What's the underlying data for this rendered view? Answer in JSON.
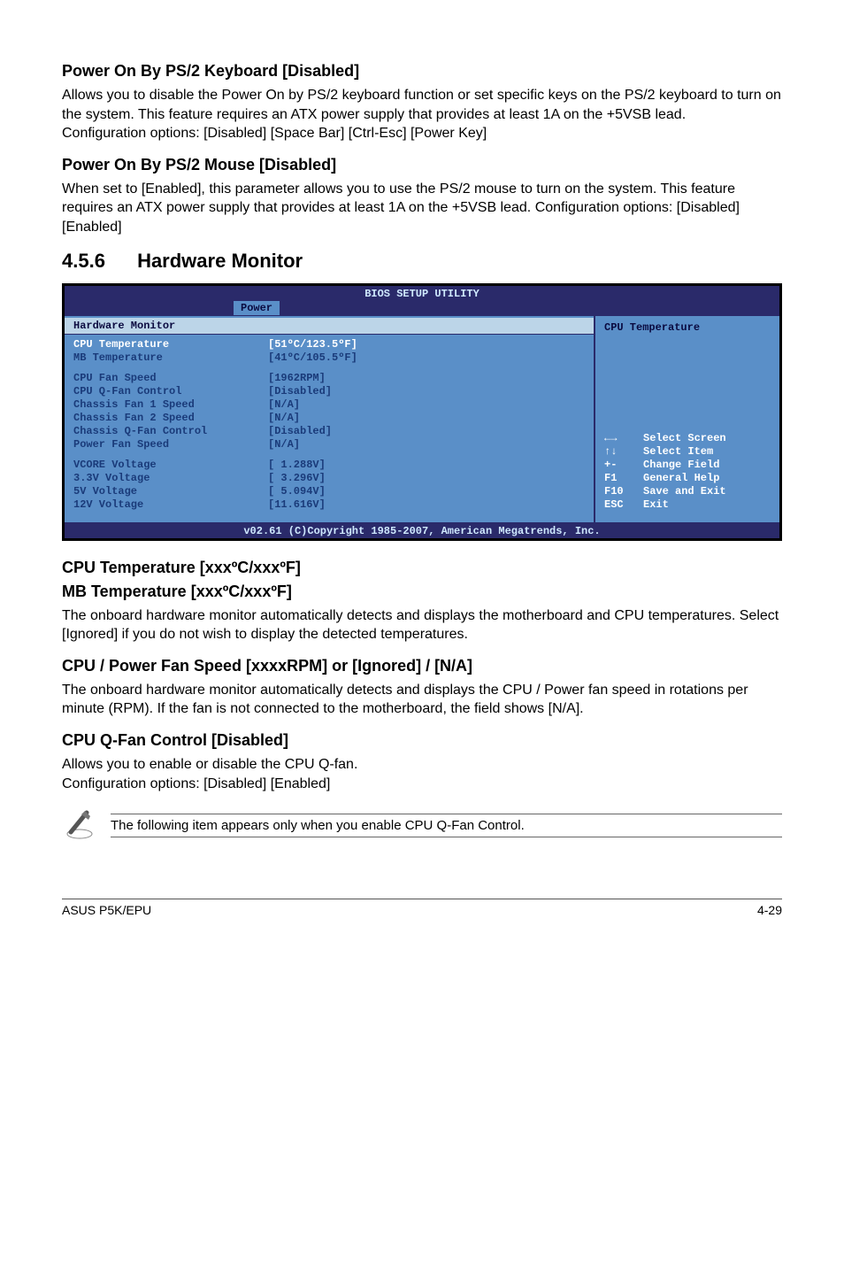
{
  "sections": {
    "ps2kb": {
      "title": "Power On By PS/2 Keyboard [Disabled]",
      "body": "Allows you to disable the Power On by PS/2 keyboard function or set specific keys on the PS/2 keyboard to turn on the system. This feature requires an ATX power supply that provides at least 1A on the +5VSB lead.",
      "opts": "Configuration options: [Disabled] [Space Bar] [Ctrl-Esc] [Power Key]"
    },
    "ps2mouse": {
      "title": "Power On By PS/2 Mouse [Disabled]",
      "body": "When set to [Enabled], this parameter allows you to use the PS/2 mouse to turn on the system. This feature requires an ATX power supply that provides at least 1A on the +5VSB lead. Configuration options: [Disabled] [Enabled]"
    },
    "hwmon": {
      "num": "4.5.6",
      "title": "Hardware Monitor"
    },
    "cputemp": {
      "title1": "CPU Temperature [xxxºC/xxxºF]",
      "title2": "MB Temperature [xxxºC/xxxºF]",
      "body": "The onboard hardware monitor automatically detects and displays the motherboard and CPU temperatures. Select [Ignored] if you do not wish to display the detected temperatures."
    },
    "fanspeed": {
      "title": "CPU / Power Fan Speed [xxxxRPM] or [Ignored] / [N/A]",
      "body": "The onboard hardware monitor automatically detects and displays the CPU / Power fan speed in rotations per minute (RPM). If the fan is not connected to the motherboard, the field shows [N/A]."
    },
    "qfan": {
      "title": "CPU Q-Fan Control [Disabled]",
      "body": "Allows you to enable or disable the CPU Q-fan.",
      "opts": "Configuration options: [Disabled] [Enabled]"
    },
    "note": "The following item appears only when you enable CPU Q-Fan Control."
  },
  "bios": {
    "title": "BIOS SETUP UTILITY",
    "tab": "Power",
    "group": "Hardware Monitor",
    "help": "CPU Temperature",
    "rows1": [
      {
        "label": "CPU Temperature",
        "val": "[51ºC/123.5ºF]",
        "sel": true
      },
      {
        "label": "MB Temperature",
        "val": "[41ºC/105.5ºF]"
      }
    ],
    "rows2": [
      {
        "label": "CPU Fan Speed",
        "val": "[1962RPM]"
      },
      {
        "label": "CPU Q-Fan Control",
        "val": "[Disabled]"
      },
      {
        "label": "Chassis Fan 1 Speed",
        "val": "[N/A]"
      },
      {
        "label": "Chassis Fan 2 Speed",
        "val": "[N/A]"
      },
      {
        "label": "Chassis Q-Fan Control",
        "val": "[Disabled]"
      },
      {
        "label": "Power Fan Speed",
        "val": "[N/A]"
      }
    ],
    "rows3": [
      {
        "label": "VCORE Voltage",
        "val": "[ 1.288V]"
      },
      {
        "label": "3.3V  Voltage",
        "val": "[ 3.296V]"
      },
      {
        "label": "5V    Voltage",
        "val": "[ 5.094V]"
      },
      {
        "label": "12V   Voltage",
        "val": "[11.616V]"
      }
    ],
    "nav": [
      {
        "key": "←→",
        "txt": "Select Screen"
      },
      {
        "key": "↑↓",
        "txt": "Select Item"
      },
      {
        "key": "+-",
        "txt": " Change Field"
      },
      {
        "key": "F1",
        "txt": "General Help"
      },
      {
        "key": "F10",
        "txt": "Save and Exit"
      },
      {
        "key": "ESC",
        "txt": "Exit"
      }
    ],
    "footer": "v02.61 (C)Copyright 1985-2007, American Megatrends, Inc."
  },
  "pagefooter": {
    "left": "ASUS P5K/EPU",
    "right": "4-29"
  }
}
